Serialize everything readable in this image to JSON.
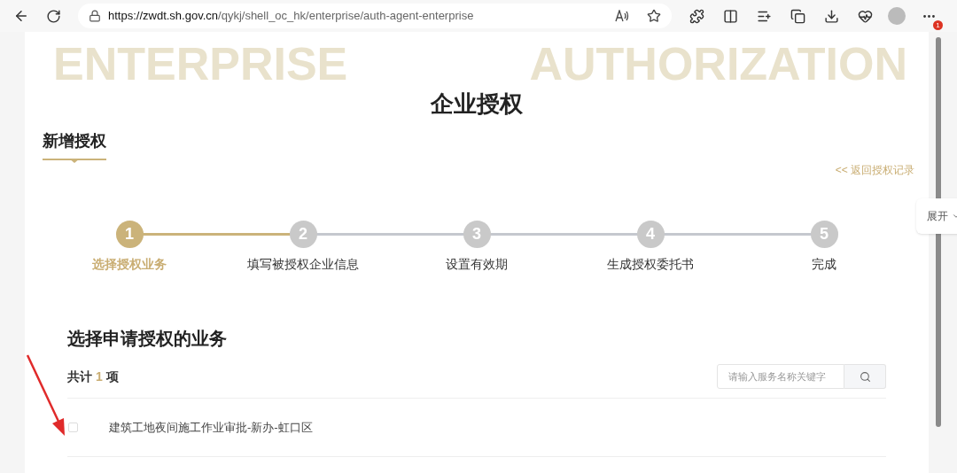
{
  "browser": {
    "url_host": "https://zwdt.sh.gov.cn",
    "url_path": "/qykj/shell_oc_hk/enterprise/auth-agent-enterprise",
    "badge": "1"
  },
  "header": {
    "background_text": "ENTERPRISE AUTHORIZATION",
    "title": "企业授权"
  },
  "tab": {
    "label": "新增授权",
    "selected": true
  },
  "back_link": "<< 返回授权记录",
  "side_toggle": "展开",
  "steps": [
    {
      "number": "1",
      "label": "选择授权业务",
      "selected": true
    },
    {
      "number": "2",
      "label": "填写被授权企业信息",
      "selected": false
    },
    {
      "number": "3",
      "label": "设置有效期",
      "selected": false
    },
    {
      "number": "4",
      "label": "生成授权委托书",
      "selected": false
    },
    {
      "number": "5",
      "label": "完成",
      "selected": false
    }
  ],
  "section": {
    "title": "选择申请授权的业务",
    "count_prefix": "共计",
    "count": "1",
    "count_suffix": "项",
    "search": {
      "placeholder": "请输入服务名称关键字"
    }
  },
  "rows": [
    {
      "label": "建筑工地夜间施工作业审批-新办-虹口区",
      "checked": false
    }
  ]
}
